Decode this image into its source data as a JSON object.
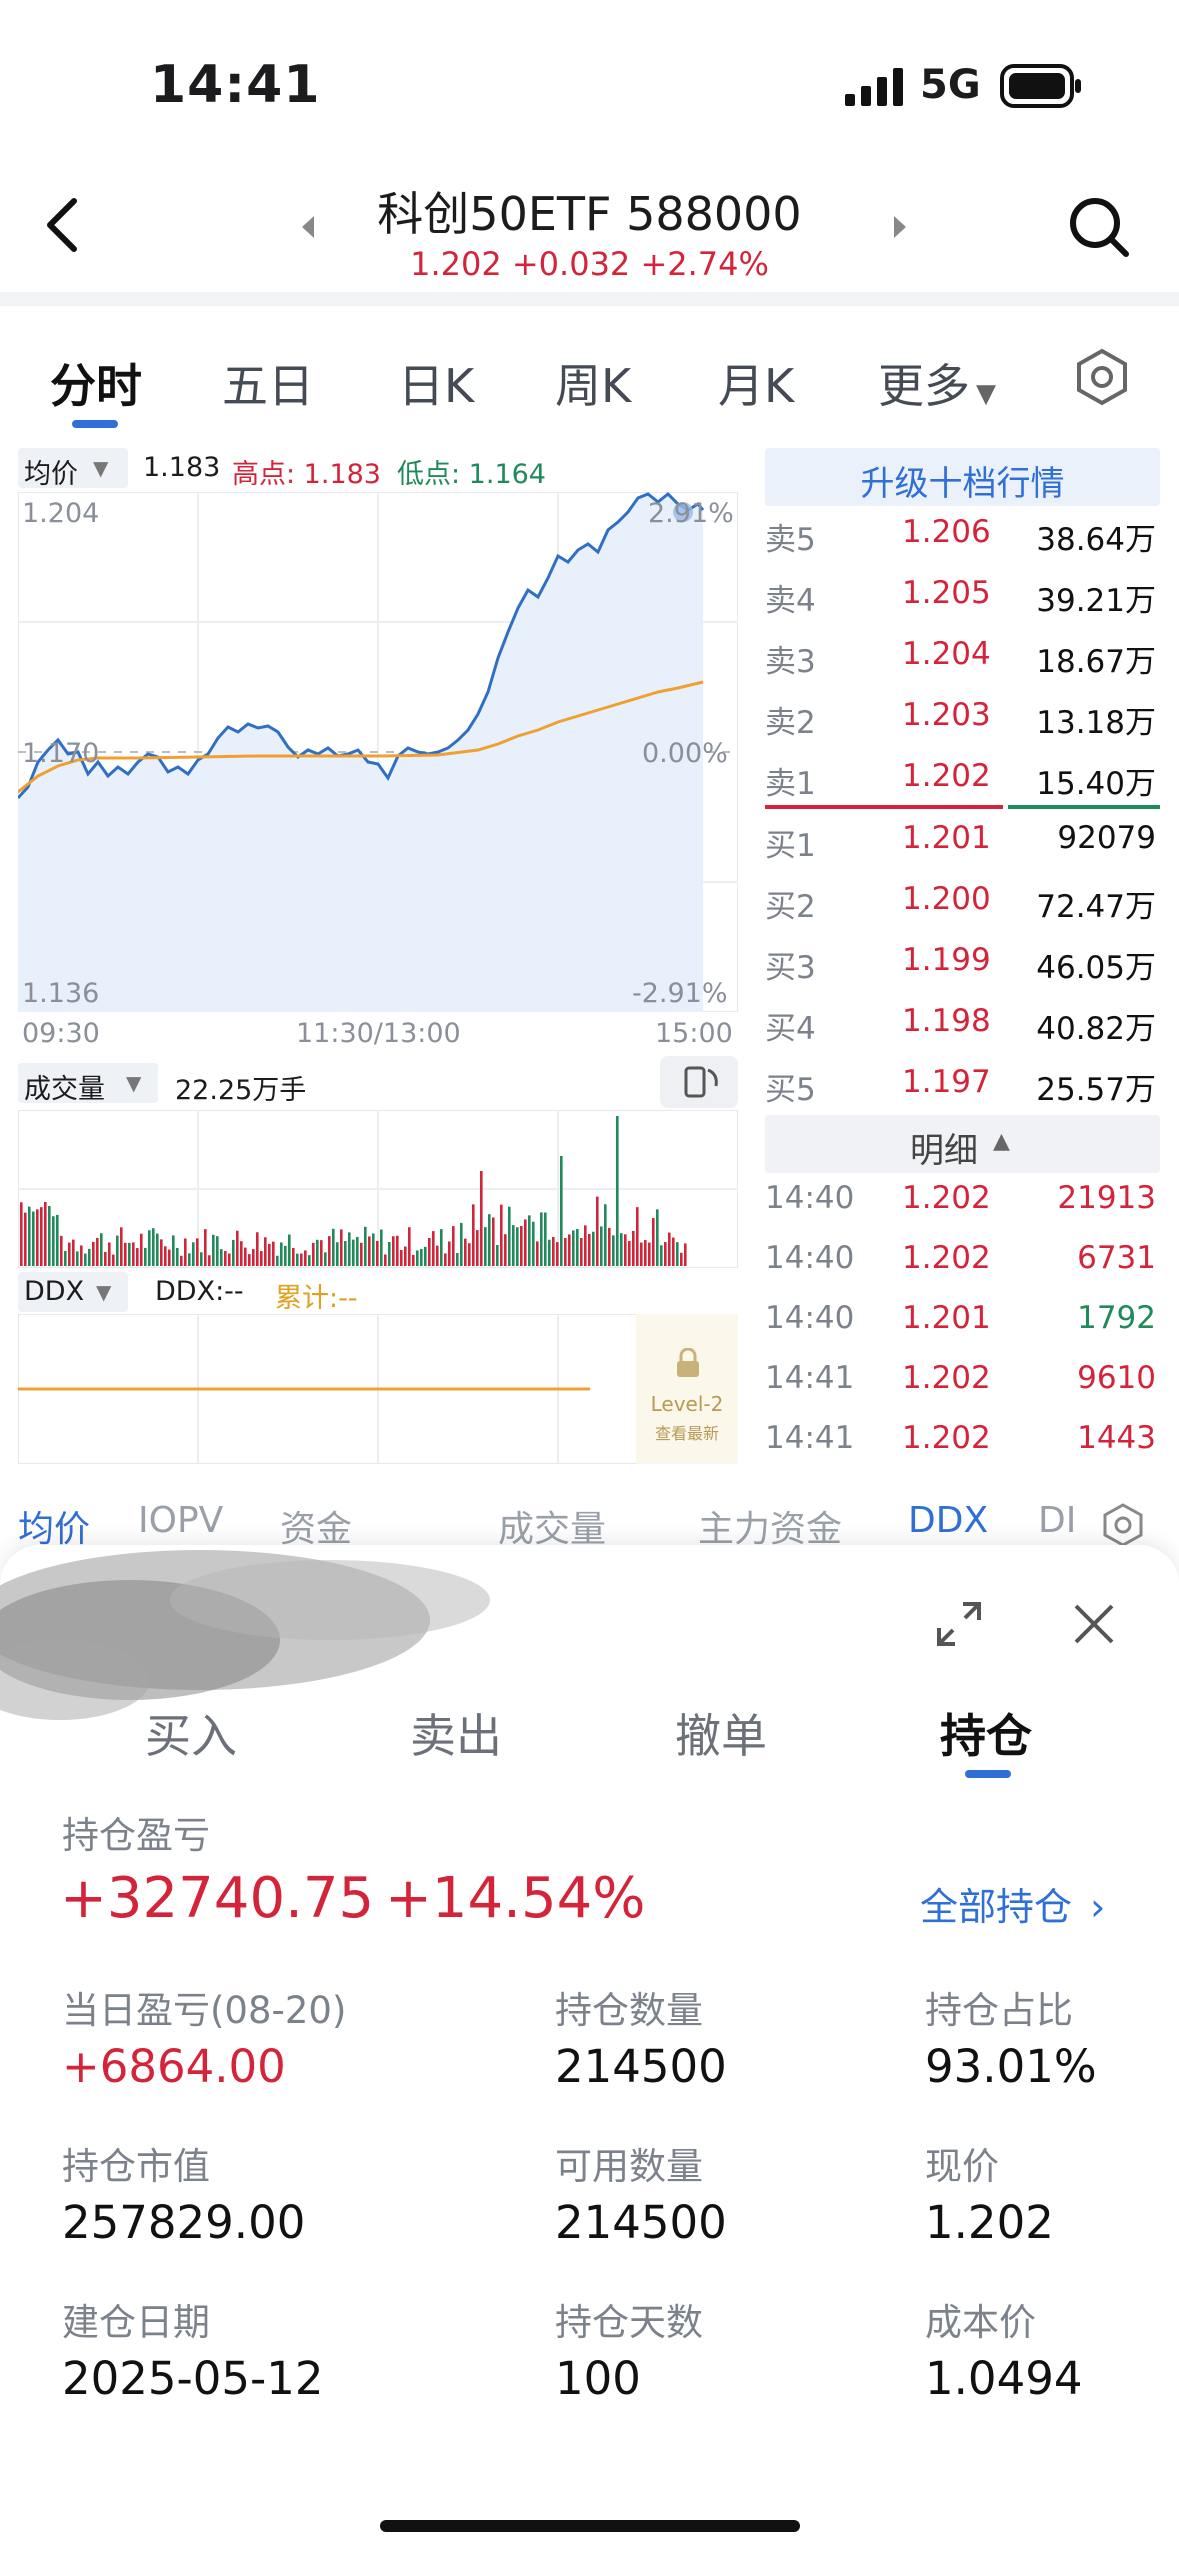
{
  "status_bar": {
    "time": "14:41",
    "network": "5G"
  },
  "header": {
    "title": "科创50ETF 588000",
    "price": "1.202 +0.032 +2.74%"
  },
  "tabs": [
    "分时",
    "五日",
    "日K",
    "周K",
    "月K",
    "更多"
  ],
  "chart_panel": {
    "avg_label": "均价",
    "avg_value": "1.183",
    "high": "高点: 1.183",
    "low": "低点: 1.164",
    "y_top": "1.204",
    "y_mid": "1.170",
    "y_bottom": "1.136",
    "pct_top": "2.91%",
    "pct_mid": "0.00%",
    "pct_bottom": "-2.91%",
    "time_start": "09:30",
    "time_mid": "11:30/13:00",
    "time_end": "15:00",
    "volume_label": "成交量",
    "volume_value": "22.25万手",
    "ddx_label": "DDX",
    "ddx_value": "DDX:--",
    "ddx_cum": "累计:--",
    "level2_label": "Level-2",
    "level2_sub": "查看最新"
  },
  "indicator_tabs": [
    "均价",
    "IOPV",
    "资金",
    "成交量",
    "主力资金",
    "DDX",
    "DI"
  ],
  "orderbook": {
    "upgrade_label": "升级十档行情",
    "asks": [
      {
        "label": "卖5",
        "price": "1.206",
        "vol": "38.64万"
      },
      {
        "label": "卖4",
        "price": "1.205",
        "vol": "39.21万"
      },
      {
        "label": "卖3",
        "price": "1.204",
        "vol": "18.67万"
      },
      {
        "label": "卖2",
        "price": "1.203",
        "vol": "13.18万"
      },
      {
        "label": "卖1",
        "price": "1.202",
        "vol": "15.40万"
      }
    ],
    "bids": [
      {
        "label": "买1",
        "price": "1.201",
        "vol": "92079"
      },
      {
        "label": "买2",
        "price": "1.200",
        "vol": "72.47万"
      },
      {
        "label": "买3",
        "price": "1.199",
        "vol": "46.05万"
      },
      {
        "label": "买4",
        "price": "1.198",
        "vol": "40.82万"
      },
      {
        "label": "买5",
        "price": "1.197",
        "vol": "25.57万"
      }
    ],
    "detail_label": "明细",
    "ticks": [
      {
        "time": "14:40",
        "price": "1.202",
        "vol": "21913",
        "color": "#d4243a"
      },
      {
        "time": "14:40",
        "price": "1.202",
        "vol": "6731",
        "color": "#d4243a"
      },
      {
        "time": "14:40",
        "price": "1.201",
        "vol": "1792",
        "color": "#1f8a5a"
      },
      {
        "time": "14:41",
        "price": "1.202",
        "vol": "9610",
        "color": "#d4243a"
      },
      {
        "time": "14:41",
        "price": "1.202",
        "vol": "1443",
        "color": "#d4243a"
      }
    ]
  },
  "trade_tabs": [
    "买入",
    "卖出",
    "撤单",
    "持仓"
  ],
  "position": {
    "pnl_label": "持仓盈亏",
    "pnl_value": "+32740.75",
    "pnl_pct": "+14.54%",
    "all_positions": "全部持仓",
    "fields": [
      {
        "label": "当日盈亏(08-20)",
        "value": "+6864.00",
        "color": "#d4243a"
      },
      {
        "label": "持仓数量",
        "value": "214500",
        "color": "#111111"
      },
      {
        "label": "持仓占比",
        "value": "93.01%",
        "color": "#111111"
      },
      {
        "label": "持仓市值",
        "value": "257829.00",
        "color": "#111111"
      },
      {
        "label": "可用数量",
        "value": "214500",
        "color": "#111111"
      },
      {
        "label": "现价",
        "value": "1.202",
        "color": "#111111"
      },
      {
        "label": "建仓日期",
        "value": "2025-05-12",
        "color": "#111111"
      },
      {
        "label": "持仓天数",
        "value": "100",
        "color": "#111111"
      },
      {
        "label": "成本价",
        "value": "1.0494",
        "color": "#111111"
      }
    ]
  },
  "colors": {
    "up": "#d4243a",
    "down": "#1f8a5a",
    "accent": "#2f6fd6",
    "avg_line": "#f0a030",
    "price_line": "#2f6fc6"
  }
}
